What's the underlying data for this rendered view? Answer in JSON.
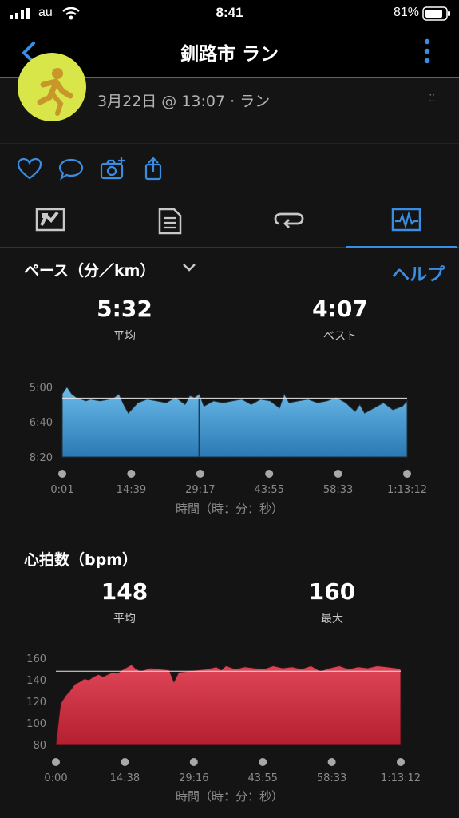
{
  "status_bar": {
    "carrier": "au",
    "time": "8:41",
    "battery": "81%"
  },
  "nav": {
    "title": "釧路市 ラン"
  },
  "activity": {
    "subtitle": "3月22日 @ 13:07 · ラン",
    "corner_mark": "⁚⁚"
  },
  "icons": {
    "back": "chevron-left-icon",
    "more": "more-vertical-icon",
    "like": "heart-icon",
    "comment": "comment-icon",
    "photo": "camera-add-icon",
    "share": "share-icon",
    "tab1": "map-stats-icon",
    "tab2": "document-icon",
    "tab3": "laps-icon",
    "tab4": "chart-icon"
  },
  "colors": {
    "accent": "#3a8de0",
    "pace_fill": "#4aa3dc",
    "hr_fill": "#cc2d3f",
    "background": "#141414"
  },
  "pace": {
    "title": "ペース（分／km）",
    "help": "ヘルプ",
    "avg_value": "5:32",
    "avg_label": "平均",
    "best_value": "4:07",
    "best_label": "ベスト",
    "axis_title": "時間（時：分：秒）"
  },
  "heart_rate": {
    "title": "心拍数（bpm）",
    "avg_value": "148",
    "avg_label": "平均",
    "max_value": "160",
    "max_label": "最大",
    "axis_title": "時間（時：分：秒）"
  },
  "chart_data": [
    {
      "type": "area",
      "ylabel": "",
      "y_ticks": [
        "5:00",
        "6:40",
        "8:20"
      ],
      "y_inverted": true,
      "ylim_seconds": [
        290,
        500
      ],
      "x_ticks": [
        "0:01",
        "14:39",
        "29:17",
        "43:55",
        "58:33",
        "1:13:12"
      ],
      "reference_line": "5:32",
      "x_minutes": [
        0,
        1,
        2,
        3,
        5,
        6,
        8,
        10,
        11,
        12,
        13,
        14,
        16,
        18,
        20,
        22,
        24,
        26,
        27,
        28,
        29,
        30,
        32,
        34,
        36,
        38,
        40,
        42,
        44,
        46,
        47,
        48,
        50,
        52,
        54,
        56,
        58,
        60,
        62,
        63,
        64,
        66,
        68,
        70,
        72,
        73
      ],
      "y_seconds": [
        320,
        300,
        320,
        330,
        340,
        335,
        340,
        335,
        330,
        320,
        350,
        375,
        345,
        335,
        340,
        345,
        330,
        350,
        325,
        330,
        320,
        355,
        340,
        345,
        340,
        335,
        350,
        335,
        340,
        360,
        320,
        345,
        340,
        335,
        345,
        340,
        330,
        345,
        370,
        350,
        375,
        360,
        345,
        365,
        355,
        340
      ]
    },
    {
      "type": "area",
      "ylabel": "",
      "y_ticks": [
        "160",
        "140",
        "120",
        "100",
        "80"
      ],
      "ylim": [
        80,
        160
      ],
      "x_ticks": [
        "0:00",
        "14:38",
        "29:16",
        "43:55",
        "58:33",
        "1:13:12"
      ],
      "reference_line": 148,
      "x_minutes": [
        0,
        0.5,
        1,
        2,
        3,
        4,
        5,
        6,
        7,
        8,
        9,
        10,
        12,
        13,
        14,
        16,
        17,
        18,
        20,
        22,
        24,
        25,
        26,
        28,
        30,
        32,
        34,
        35,
        36,
        38,
        40,
        42,
        44,
        46,
        48,
        50,
        52,
        54,
        56,
        58,
        60,
        62,
        64,
        66,
        68,
        70,
        72,
        73
      ],
      "values": [
        80,
        100,
        118,
        125,
        130,
        136,
        138,
        141,
        140,
        143,
        145,
        143,
        147,
        146,
        149,
        154,
        150,
        148,
        151,
        150,
        149,
        138,
        147,
        148,
        149,
        150,
        152,
        149,
        153,
        150,
        152,
        151,
        150,
        153,
        151,
        152,
        150,
        153,
        148,
        151,
        153,
        150,
        152,
        151,
        153,
        152,
        151,
        150
      ]
    }
  ]
}
